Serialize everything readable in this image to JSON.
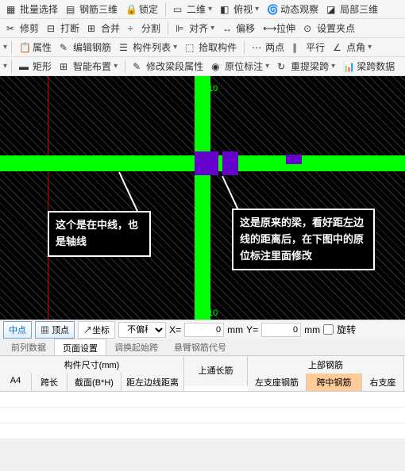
{
  "toolbar1": {
    "batch_select": "批量选择",
    "rebar_3d": "钢筋三维",
    "lock": "锁定",
    "view_2d": "二维",
    "overlook": "俯视",
    "dynamic_view": "动态观察",
    "local_3d": "局部三维"
  },
  "toolbar2": {
    "trim": "修剪",
    "break": "打断",
    "merge": "合并",
    "split": "分割",
    "align": "对齐",
    "offset": "偏移",
    "stretch": "拉伸",
    "set_grip": "设置夹点"
  },
  "toolbar3": {
    "properties": "属性",
    "edit_rebar": "编辑钢筋",
    "component_list": "构件列表",
    "pick_component": "拾取构件",
    "two_point": "两点",
    "parallel": "平行",
    "point_angle": "点角"
  },
  "toolbar4": {
    "rect": "矩形",
    "smart_layout": "智能布置",
    "modify_beam_attr": "修改梁段属性",
    "origin_annotate": "原位标注",
    "reset_beam_span": "重提梁跨",
    "beam_span_data": "梁跨数据"
  },
  "annotations": {
    "left_box": "这个是在中线，也是轴线",
    "right_box": "这是原来的梁，看好距左边线的距离后，在下图中的原位标注里面修改",
    "marker_top": "10",
    "marker_bottom": "10"
  },
  "coord_bar": {
    "midpoint": "中点",
    "vertex": "顶点",
    "coordinate": "坐标",
    "no_offset": "不偏移",
    "x_label": "X=",
    "x_val": "0",
    "y_label": "Y=",
    "y_val": "0",
    "mm": "mm",
    "rotate": "旋转"
  },
  "tabs": {
    "front_data": "前列数据",
    "page_setup": "页面设置",
    "adjust_span": "调换起始跨",
    "cantilever_rebar": "悬臂钢筋代号"
  },
  "table": {
    "component_size": "构件尺寸(mm)",
    "upper_long_rebar": "上通长筋",
    "upper_rebar": "上部钢筋",
    "a4": "A4",
    "span": "跨长",
    "section": "截面(B*H)",
    "dist_left_edge": "距左边线距离",
    "left_support_rebar": "左支座钢筋",
    "mid_span_rebar": "跨中钢筋",
    "right_support": "右支座"
  }
}
